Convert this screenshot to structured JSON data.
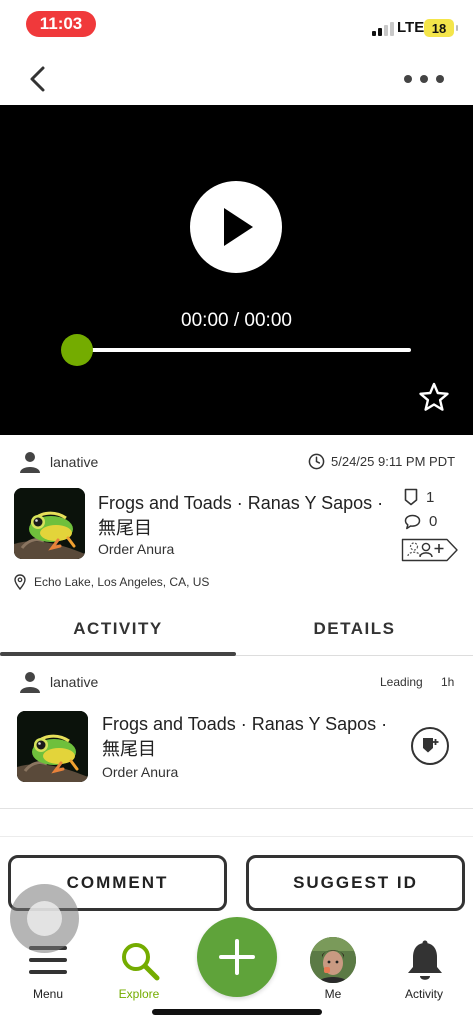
{
  "status_bar": {
    "time": "11:03",
    "network": "LTE",
    "battery": "18"
  },
  "colors": {
    "accent": "#74ac00",
    "time_pill": "#f0393b",
    "fab": "#5fa33a"
  },
  "player": {
    "time_display": "00:00 / 00:00",
    "progress": 0
  },
  "observation": {
    "username": "lanative",
    "date": "5/24/25 9:11 PM PDT",
    "taxon_name": "Frogs and Toads · Ranas Y Sapos · 無尾目",
    "taxon_rank": "Order Anura",
    "id_count": "1",
    "comment_count": "0",
    "location": "Echo Lake, Los Angeles, CA, US"
  },
  "tabs": [
    {
      "label": "ACTIVITY",
      "active": true
    },
    {
      "label": "DETAILS",
      "active": false
    }
  ],
  "activity": {
    "username": "lanative",
    "status": "Leading",
    "age": "1h",
    "taxon_name": "Frogs and Toads · Ranas Y Sapos · 無尾目",
    "taxon_rank": "Order Anura"
  },
  "actions": {
    "comment": "COMMENT",
    "suggest_id": "SUGGEST ID"
  },
  "bottom_nav": {
    "menu": "Menu",
    "explore": "Explore",
    "me": "Me",
    "activity": "Activity"
  },
  "icons": [
    "back-icon",
    "more-icon",
    "play-icon",
    "star-icon",
    "user-icon",
    "clock-icon",
    "id-icon",
    "comment-icon",
    "tag-icon",
    "location-icon",
    "agree-icon",
    "menu-icon",
    "search-icon",
    "plus-icon",
    "bell-icon"
  ]
}
